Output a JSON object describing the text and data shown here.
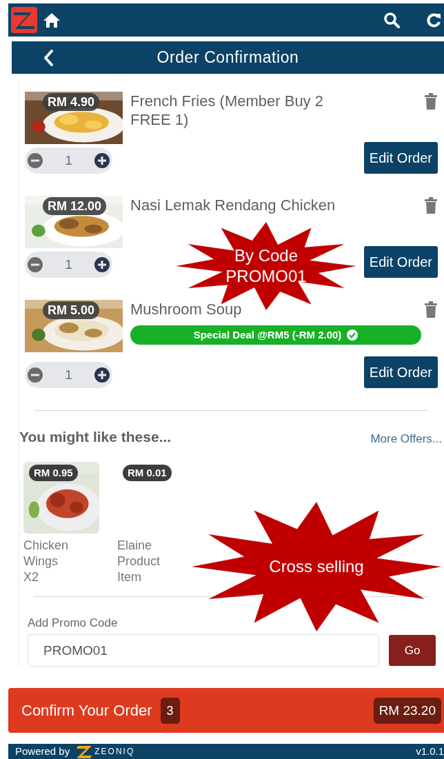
{
  "page_title": "Order Confirmation",
  "cart_items": [
    {
      "name": "French Fries (Member Buy 2 FREE 1)",
      "price": "RM 4.90",
      "quantity": "1",
      "button": "Edit Order"
    },
    {
      "name": "Nasi Lemak Rendang Chicken",
      "price": "RM 12.00",
      "quantity": "1",
      "button": "Edit Order"
    },
    {
      "name": "Mushroom Soup",
      "price": "RM 5.00",
      "quantity": "1",
      "button": "Edit Order",
      "deal": "Special Deal @RM5 (-RM 2.00)"
    }
  ],
  "suggestions": {
    "title": "You might like these...",
    "more_link": "More Offers...",
    "items": [
      {
        "price": "RM 0.95",
        "name": "Chicken Wings X2"
      },
      {
        "price": "RM 0.01",
        "name": "Elaine Product Item"
      }
    ]
  },
  "promo": {
    "label": "Add Promo Code",
    "value": "PROMO01",
    "button": "Go"
  },
  "confirm_bar": {
    "label": "Confirm Your Order",
    "count": "3",
    "total": "RM 23.20"
  },
  "footer": {
    "powered_by": "Powered by",
    "brand": "ZEONIQ",
    "version": "v1.0.1"
  },
  "annotations": [
    {
      "lines": [
        "By Code",
        "PROMO01"
      ]
    },
    {
      "lines": [
        "Cross selling"
      ]
    }
  ]
}
